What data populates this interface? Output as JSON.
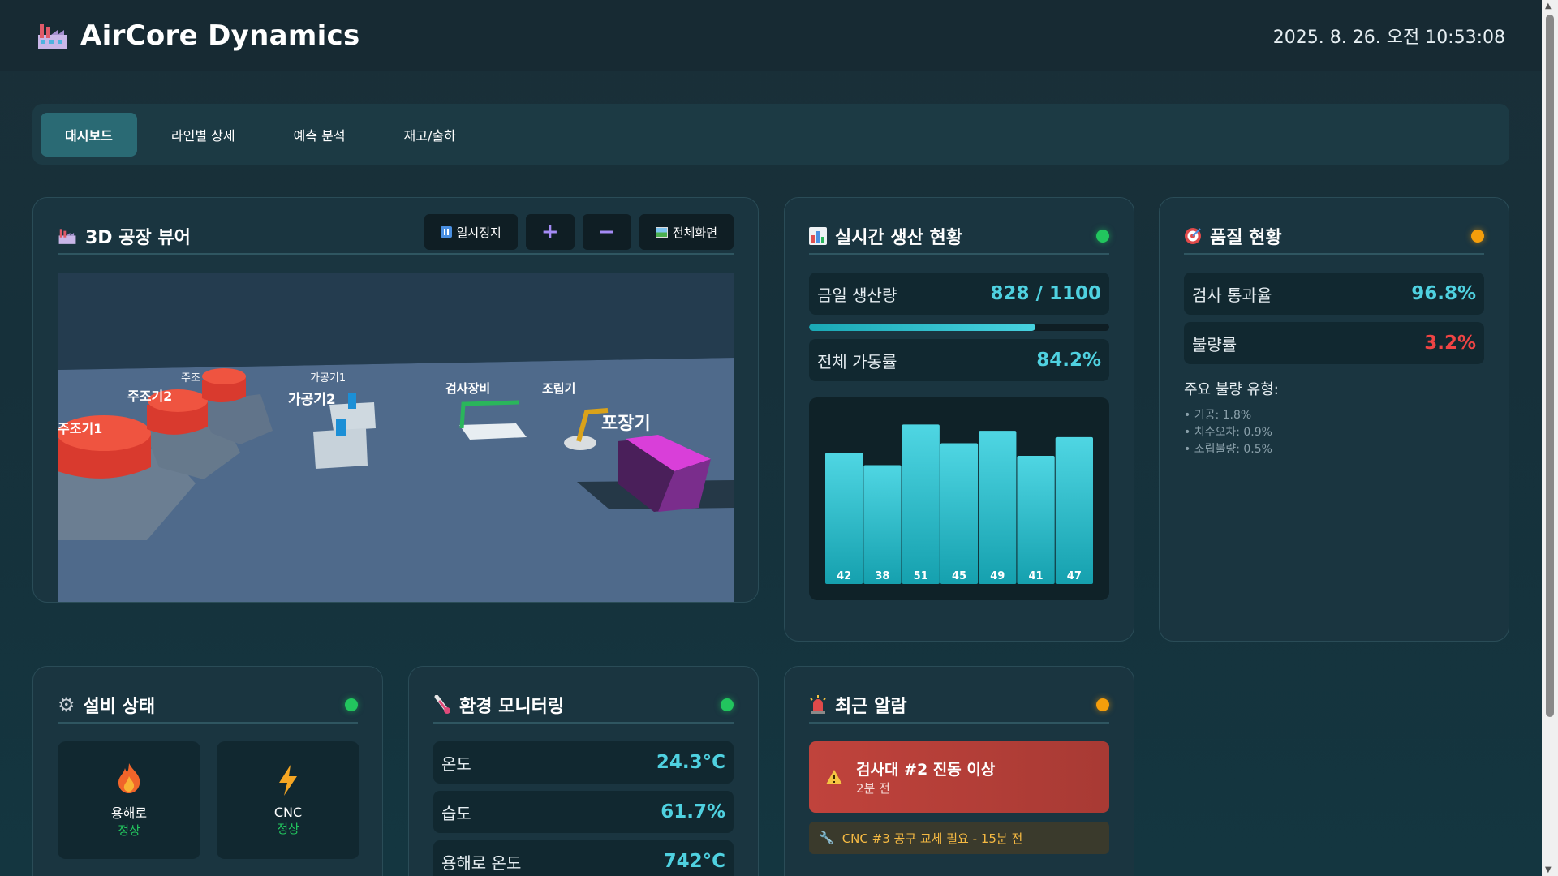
{
  "header": {
    "title": "AirCore Dynamics",
    "datetime": "2025. 8. 26. 오전 10:53:08",
    "logo_icon": "factory-icon"
  },
  "tabs": [
    {
      "label": "대시보드",
      "active": true
    },
    {
      "label": "라인별 상세",
      "active": false
    },
    {
      "label": "예측 분석",
      "active": false
    },
    {
      "label": "재고/출하",
      "active": false
    }
  ],
  "factory_viewer": {
    "title": "3D 공장 뷰어",
    "pause_label": "일시정지",
    "zoom_in_label": "+",
    "zoom_out_label": "−",
    "fullscreen_label": "전체화면",
    "scene_labels": {
      "casting1": "주조기1",
      "casting2": "주조기2",
      "casting3": "주조",
      "machining1": "가공기1",
      "machining2": "가공기2",
      "inspection": "검사장비",
      "assembly": "조립기",
      "packaging": "포장기"
    }
  },
  "production": {
    "title": "실시간 생산 현황",
    "status_color": "#22c55e",
    "daily_label": "금일 생산량",
    "daily_value": "828 / 1100",
    "progress": 0.753,
    "uptime_label": "전체 가동률",
    "uptime_value": "84.2%"
  },
  "chart_data": {
    "type": "bar",
    "values": [
      42,
      38,
      51,
      45,
      49,
      41,
      47
    ],
    "value_labels": [
      "42",
      "38",
      "51",
      "45",
      "49",
      "41",
      "47"
    ],
    "ylim": [
      0,
      55
    ],
    "color": "#3cc8d6"
  },
  "quality": {
    "title": "품질 현황",
    "status_color": "#f59e0b",
    "pass_label": "검사 통과율",
    "pass_value": "96.8%",
    "defect_label": "불량률",
    "defect_value": "3.2%",
    "defect_types_title": "주요 불량 유형:",
    "defect_types": [
      "• 기공: 1.8%",
      "• 치수오차: 0.9%",
      "• 조립불량: 0.5%"
    ]
  },
  "equipment": {
    "title": "설비 상태",
    "status_color": "#22c55e",
    "items": [
      {
        "name": "용해로",
        "status": "정상",
        "icon": "fire-icon"
      },
      {
        "name": "CNC",
        "status": "정상",
        "icon": "lightning-icon"
      }
    ]
  },
  "environment": {
    "title": "환경 모니터링",
    "status_color": "#22c55e",
    "rows": [
      {
        "label": "온도",
        "value": "24.3°C"
      },
      {
        "label": "습도",
        "value": "61.7%"
      },
      {
        "label": "용해로 온도",
        "value": "742°C"
      }
    ]
  },
  "alarms": {
    "title": "최근 알람",
    "status_color": "#f59e0b",
    "critical": {
      "title": "검사대 #2 진동 이상",
      "time": "2분 전"
    },
    "warning": "CNC #3 공구 교체 필요 - 15분 전"
  }
}
